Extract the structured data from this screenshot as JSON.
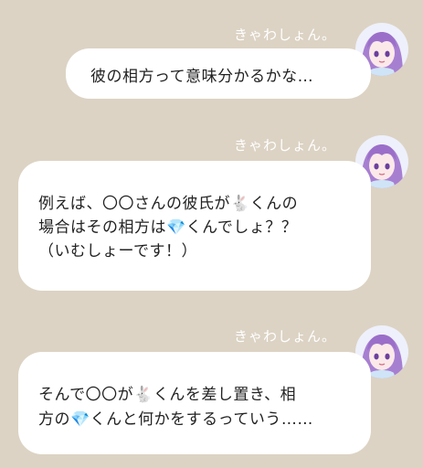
{
  "chat": {
    "messages": [
      {
        "sender": "きゃわしょん。",
        "lines": [
          "彼の相方って意味分かるかな…"
        ],
        "avatar_icon": "purple-hair-girl-avatar-icon"
      },
      {
        "sender": "きゃわしょん。",
        "lines": [
          "例えば、〇〇さんの彼氏が🐇くんの",
          "場合はその相方は💎くんでしょ？？",
          "（いむしょーです！）"
        ],
        "avatar_icon": "purple-hair-girl-avatar-icon"
      },
      {
        "sender": "きゃわしょん。",
        "lines": [
          "そんで〇〇が🐇くんを差し置き、相",
          "方の💎くんと何かをするっていう……"
        ],
        "avatar_icon": "purple-hair-girl-avatar-icon"
      }
    ]
  },
  "colors": {
    "background": "#dcd3c4",
    "bubble": "#ffffff",
    "sender_text": "#ffffff",
    "avatar_hair": "#a77fd1"
  }
}
